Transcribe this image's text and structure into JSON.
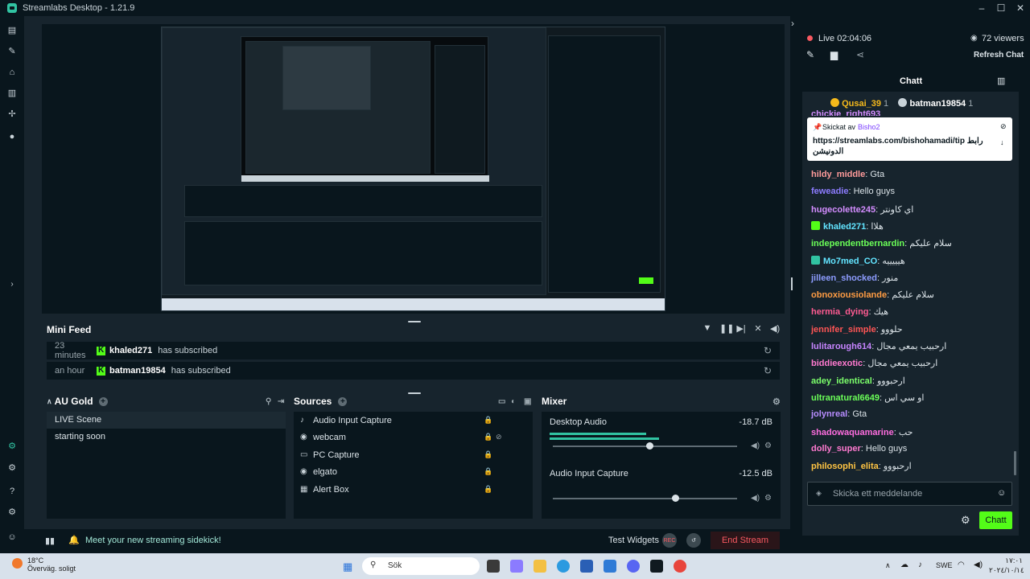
{
  "window": {
    "title": "Streamlabs Desktop - 1.21.9",
    "controls": [
      "–",
      "☐",
      "✕"
    ]
  },
  "mini_feed": {
    "title": "Mini Feed",
    "events": [
      {
        "time": "23 minutes",
        "user": "khaled271",
        "action": "has subscribed"
      },
      {
        "time": "an hour",
        "user": "batman19854",
        "action": "has subscribed"
      }
    ]
  },
  "scenes": {
    "collection": "AU Gold",
    "items": [
      "LIVE Scene",
      "starting soon"
    ],
    "selected": "LIVE Scene"
  },
  "sources": {
    "title": "Sources",
    "items": [
      "Audio Input Capture",
      "webcam",
      "PC Capture",
      "elgato",
      "Alert Box"
    ]
  },
  "mixer": {
    "title": "Mixer",
    "channels": [
      {
        "name": "Desktop Audio",
        "db": "-18.7 dB",
        "level": 0.65
      },
      {
        "name": "Audio Input Capture",
        "db": "-12.5 dB",
        "level": 0.7
      }
    ]
  },
  "footer": {
    "sidekick": "Meet your new streaming sidekick!",
    "test_widgets": "Test Widgets",
    "end_stream": "End Stream",
    "rec": "REC"
  },
  "live": {
    "status": "Live 02:04:06",
    "viewers": "72 viewers",
    "refresh_chat": "Refresh Chat"
  },
  "chat": {
    "title": "Chatt",
    "top_users": [
      {
        "name": "Qusai_39",
        "count": "1"
      },
      {
        "name": "batman19854",
        "count": "1"
      }
    ],
    "pinned": {
      "by_label": "Skickat av",
      "by_user": "Bisho2",
      "message": "https://streamlabs.com/bishohamadi/tip رابط الدونيشن"
    },
    "messages": [
      {
        "user": "hildy_middle",
        "text": "Gta",
        "color": "#ff9b9b"
      },
      {
        "user": "feweadie",
        "text": "Hello guys",
        "color": "#8d7cff"
      },
      {
        "user": "hugecolette245",
        "text": "اي كاونتر",
        "color": "#d48dff"
      },
      {
        "user": "khaled271",
        "text": "هلاا",
        "color": "#62e4ff",
        "badge": "green"
      },
      {
        "user": "independentbernardin",
        "text": "سلام عليكم",
        "color": "#6bff58"
      },
      {
        "user": "Mo7med_CO",
        "text": "هيييييه",
        "color": "#62e4ff",
        "badge": "teal"
      },
      {
        "user": "jilleen_shocked",
        "text": "منور",
        "color": "#8d9cff"
      },
      {
        "user": "obnoxiousiolande",
        "text": "سلام عليكم",
        "color": "#ff9c43"
      },
      {
        "user": "hermia_dying",
        "text": "هيك",
        "color": "#ff5b92"
      },
      {
        "user": "jennifer_simple",
        "text": "حلووو",
        "color": "#ff5555"
      },
      {
        "user": "lulitarough614",
        "text": "ارحبيب يمعي مجال",
        "color": "#c785ff"
      },
      {
        "user": "biddieexotic",
        "text": "ارحبيب يمعي مجال",
        "color": "#ff7ad0"
      },
      {
        "user": "adey_identical",
        "text": "ارحبووو",
        "color": "#7cff6b"
      },
      {
        "user": "ultranatural6649",
        "text": "او سي اس",
        "color": "#6bff58"
      },
      {
        "user": "jolynreal",
        "text": "Gta",
        "color": "#b88dff"
      },
      {
        "user": "shadowaquamarine",
        "text": "حب",
        "color": "#ff6ee0"
      },
      {
        "user": "dolly_super",
        "text": "Hello guys",
        "color": "#ff7ad0"
      },
      {
        "user": "philosophi_elita",
        "text": "ارحبووو",
        "color": "#ffc443"
      }
    ],
    "partial_top_line": "chickie_right693",
    "input_placeholder": "Skicka ett meddelande",
    "send_label": "Chatt"
  },
  "taskbar": {
    "temp": "18°C",
    "weather": "Överväg. soligt",
    "search": "Sök",
    "lang": "SWE",
    "time": "١٧:٠١",
    "date": "٢٠٢٤/١٠/١٤"
  },
  "colors": {
    "accent": "#31c3a2",
    "kick_green": "#53fc18",
    "end_stream": "#f85961",
    "live_dot": "#f85961"
  }
}
